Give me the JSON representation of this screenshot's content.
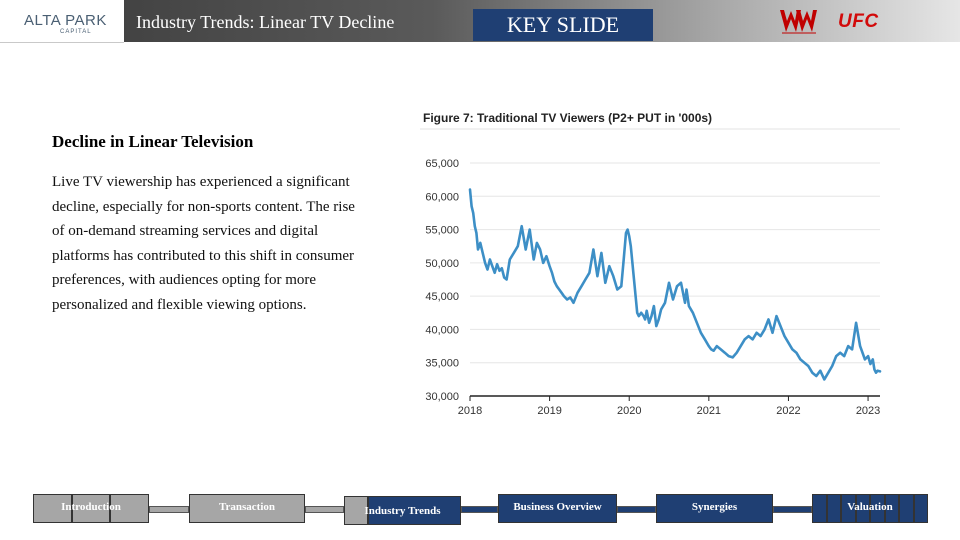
{
  "header": {
    "logo_main": "ALTA PARK",
    "logo_sub": "CAPITAL",
    "title": "Industry Trends: Linear TV Decline",
    "key_slide_label": "KEY SLIDE",
    "wwe_logo_icon": "wwe-logo-icon",
    "ufc_logo_text": "UFC",
    "colors": {
      "key_slide_bg": "#1f3f73",
      "ufc_red": "#d20a0a"
    }
  },
  "content": {
    "heading": "Decline in Linear Television",
    "body": "Live TV viewership has experienced a significant decline, especially for non-sports content. The rise of on-demand streaming services and digital platforms has contributed to this shift in consumer preferences, with audiences opting for more personalized and flexible viewing options."
  },
  "chart_data": {
    "type": "line",
    "title": "Figure 7: Traditional TV Viewers (P2+ PUT in '000s)",
    "xlabel": "",
    "ylabel": "",
    "x_ticks": [
      "2018",
      "2019",
      "2020",
      "2021",
      "2022",
      "2023"
    ],
    "y_ticks": [
      "30,000",
      "35,000",
      "40,000",
      "45,000",
      "50,000",
      "55,000",
      "60,000",
      "65,000"
    ],
    "ylim": [
      30000,
      65000
    ],
    "xlim": [
      2018.0,
      2023.15
    ],
    "grid": true,
    "line_color": "#3d8fc6",
    "series": [
      {
        "x": [
          2018.0,
          2018.02,
          2018.04,
          2018.06,
          2018.08,
          2018.1,
          2018.13,
          2018.16,
          2018.19,
          2018.22,
          2018.25,
          2018.28,
          2018.31,
          2018.34,
          2018.37,
          2018.4,
          2018.43,
          2018.46,
          2018.5,
          2018.55,
          2018.6,
          2018.65,
          2018.7,
          2018.75,
          2018.8,
          2018.84,
          2018.88,
          2018.92,
          2018.96,
          2019.0,
          2019.03,
          2019.06,
          2019.09,
          2019.12,
          2019.15,
          2019.18,
          2019.22,
          2019.26,
          2019.3,
          2019.35,
          2019.4,
          2019.45,
          2019.5,
          2019.55,
          2019.6,
          2019.65,
          2019.7,
          2019.75,
          2019.8,
          2019.85,
          2019.9,
          2019.93,
          2019.96,
          2019.98,
          2020.0,
          2020.02,
          2020.04,
          2020.06,
          2020.08,
          2020.1,
          2020.12,
          2020.15,
          2020.18,
          2020.2,
          2020.22,
          2020.25,
          2020.28,
          2020.31,
          2020.34,
          2020.37,
          2020.4,
          2020.45,
          2020.5,
          2020.55,
          2020.6,
          2020.65,
          2020.7,
          2020.72,
          2020.75,
          2020.8,
          2020.85,
          2020.9,
          2020.95,
          2021.0,
          2021.03,
          2021.06,
          2021.1,
          2021.15,
          2021.2,
          2021.25,
          2021.3,
          2021.35,
          2021.4,
          2021.45,
          2021.5,
          2021.55,
          2021.6,
          2021.65,
          2021.7,
          2021.75,
          2021.8,
          2021.85,
          2021.9,
          2021.95,
          2022.0,
          2022.05,
          2022.1,
          2022.15,
          2022.2,
          2022.25,
          2022.3,
          2022.35,
          2022.4,
          2022.45,
          2022.5,
          2022.55,
          2022.6,
          2022.65,
          2022.7,
          2022.75,
          2022.8,
          2022.85,
          2022.9,
          2022.93,
          2022.96,
          2023.0,
          2023.03,
          2023.06,
          2023.08,
          2023.1,
          2023.12,
          2023.15
        ],
        "y": [
          61000,
          58500,
          57500,
          55500,
          54500,
          52000,
          53000,
          51500,
          50000,
          49000,
          50500,
          49500,
          48500,
          49800,
          48800,
          49200,
          47800,
          47500,
          50500,
          51500,
          52500,
          55500,
          52000,
          55000,
          50500,
          53000,
          52000,
          50000,
          51000,
          49500,
          48500,
          47200,
          46500,
          46000,
          45500,
          45000,
          44500,
          44800,
          44000,
          45500,
          46500,
          47500,
          48500,
          52000,
          48000,
          51500,
          47000,
          49500,
          48000,
          46000,
          46500,
          50500,
          54500,
          55000,
          54000,
          52500,
          50000,
          47500,
          45000,
          42500,
          42000,
          42500,
          42000,
          41500,
          42800,
          41000,
          42000,
          43500,
          40500,
          41500,
          43000,
          44000,
          47000,
          44500,
          46500,
          47000,
          44000,
          46000,
          43500,
          42500,
          41000,
          39500,
          38500,
          37500,
          37000,
          36800,
          37500,
          37000,
          36500,
          36000,
          35800,
          36500,
          37500,
          38500,
          39000,
          38500,
          39500,
          39000,
          40000,
          41500,
          39500,
          42000,
          40500,
          39000,
          38000,
          37000,
          36500,
          35500,
          35000,
          34500,
          33500,
          33000,
          33800,
          32500,
          33500,
          34500,
          36000,
          36500,
          36000,
          37500,
          37000,
          41000,
          37500,
          36500,
          35500,
          36000,
          34800,
          35500,
          34000,
          33500,
          33800,
          33700
        ]
      }
    ]
  },
  "nav": {
    "items": [
      {
        "label": "Introduction",
        "active": false
      },
      {
        "label": "Transaction",
        "active": false
      },
      {
        "label": "Industry Trends",
        "active": true
      },
      {
        "label": "Business Overview",
        "active": false
      },
      {
        "label": "Synergies",
        "active": false
      },
      {
        "label": "Valuation",
        "active": false
      }
    ],
    "colors": {
      "inactive": "#a6a6a6",
      "active": "#1f3f73"
    }
  }
}
